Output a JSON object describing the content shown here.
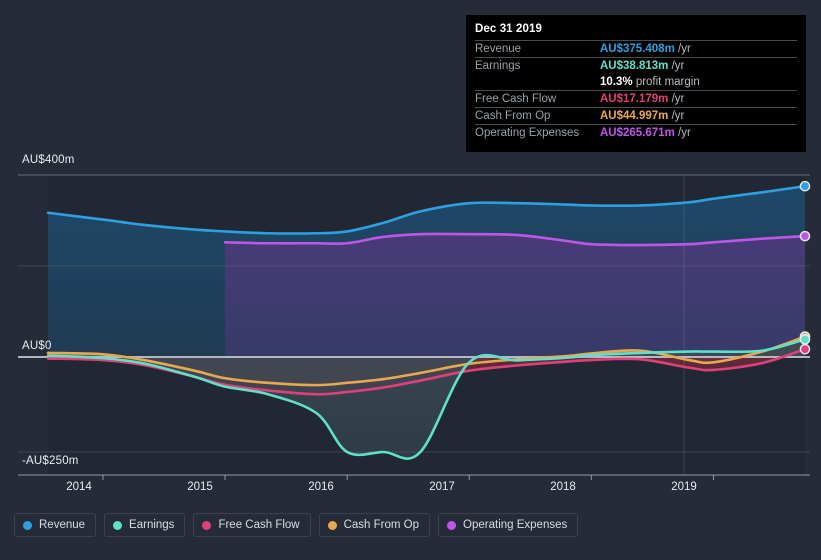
{
  "chart_data": {
    "type": "area",
    "title": "",
    "xlabel": "",
    "ylabel": "",
    "currency": "AU$",
    "grid": true,
    "legend_position": "bottom",
    "x": [
      2013.55,
      2014.0,
      2014.35,
      2014.75,
      2015.0,
      2015.35,
      2015.75,
      2016.0,
      2016.3,
      2016.6,
      2017.0,
      2017.4,
      2017.8,
      2018.0,
      2018.4,
      2018.8,
      2019.0,
      2019.4,
      2019.75
    ],
    "xticks": [
      2014,
      2015,
      2016,
      2017,
      2018,
      2019
    ],
    "xtick_labels": [
      "2014",
      "2015",
      "2016",
      "2017",
      "2018",
      "2019"
    ],
    "yticks": [
      400,
      200,
      0,
      -250
    ],
    "ytick_labels": [
      "AU$400m",
      "",
      "AU$0",
      "-AU$250m"
    ],
    "ylim": [
      -250,
      460
    ],
    "ytick_shown": [
      "AU$400m",
      "AU$0",
      "-AU$250m"
    ],
    "series": [
      {
        "name": "Revenue",
        "color": "#2e9fe0",
        "fill": "#1e4a6b",
        "values": [
          317,
          302,
          290,
          280,
          276,
          272,
          272,
          276,
          295,
          320,
          338,
          338,
          335,
          333,
          333,
          340,
          348,
          362,
          375.408
        ]
      },
      {
        "name": "Earnings",
        "color": "#5fe0c8",
        "fill": "#3a4a55",
        "values": [
          3,
          -3,
          -18,
          -52,
          -78,
          -98,
          -148,
          -250,
          -250,
          -250,
          -14,
          -9,
          -2,
          4,
          9,
          12,
          12,
          14,
          38.813
        ]
      },
      {
        "name": "Free Cash Flow",
        "color": "#e0407a",
        "fill": "#6b2a3a",
        "values": [
          -4,
          -8,
          -22,
          -52,
          -73,
          -88,
          -98,
          -92,
          -80,
          -62,
          -36,
          -22,
          -12,
          -8,
          -6,
          -28,
          -34,
          -16,
          17.179
        ]
      },
      {
        "name": "Cash From Op",
        "color": "#e8a84f",
        "fill": "#7a5c35",
        "values": [
          9,
          6,
          -9,
          -36,
          -56,
          -68,
          -74,
          -68,
          -58,
          -42,
          -18,
          -6,
          2,
          8,
          14,
          -8,
          -14,
          12,
          44.997
        ]
      },
      {
        "name": "Operating Expenses",
        "color": "#c056e8",
        "fill": "#4a3a78",
        "values": [
          null,
          null,
          null,
          null,
          252,
          250,
          250,
          250,
          264,
          270,
          270,
          268,
          255,
          248,
          246,
          248,
          252,
          260,
          265.671
        ]
      }
    ],
    "annotations": {
      "forecast_divider_x": 2019.0
    }
  },
  "tooltip": {
    "date": "Dec 31 2019",
    "rows": [
      {
        "label": "Revenue",
        "value": "AU$375.408m",
        "unit": "/yr",
        "color": "#2e9fe0"
      },
      {
        "label": "Earnings",
        "value": "AU$38.813m",
        "unit": "/yr",
        "color": "#5fe0c8"
      },
      {
        "label": "",
        "value": "10.3%",
        "unit": "profit margin",
        "color": "#ffffff"
      },
      {
        "label": "Free Cash Flow",
        "value": "AU$17.179m",
        "unit": "/yr",
        "color": "#e0407a"
      },
      {
        "label": "Cash From Op",
        "value": "AU$44.997m",
        "unit": "/yr",
        "color": "#e8a84f"
      },
      {
        "label": "Operating Expenses",
        "value": "AU$265.671m",
        "unit": "/yr",
        "color": "#c056e8"
      }
    ]
  },
  "legend": {
    "items": [
      {
        "label": "Revenue",
        "color": "#2e9fe0"
      },
      {
        "label": "Earnings",
        "color": "#5fe0c8"
      },
      {
        "label": "Free Cash Flow",
        "color": "#e0407a"
      },
      {
        "label": "Cash From Op",
        "color": "#e8a84f"
      },
      {
        "label": "Operating Expenses",
        "color": "#c056e8"
      }
    ]
  },
  "axis": {
    "y_top_label": "AU$400m",
    "y_zero_label": "AU$0",
    "y_bottom_label": "-AU$250m",
    "x_labels": [
      "2014",
      "2015",
      "2016",
      "2017",
      "2018",
      "2019"
    ]
  }
}
